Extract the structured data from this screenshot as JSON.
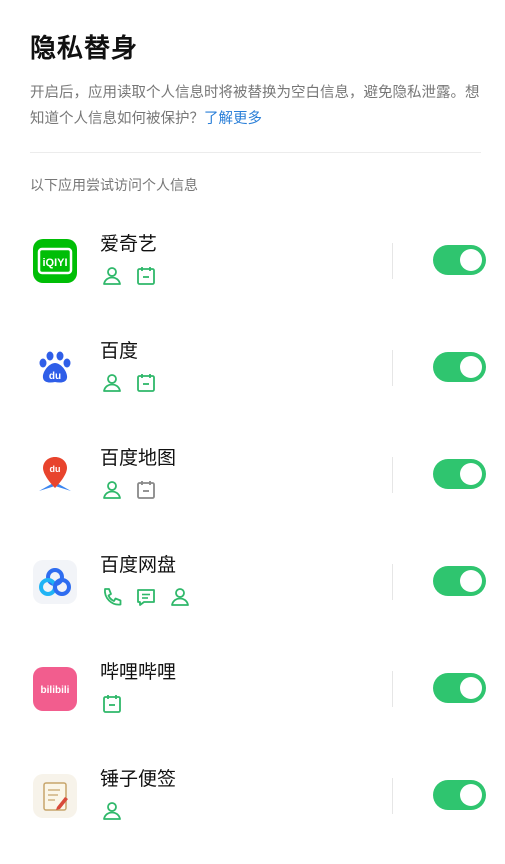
{
  "header": {
    "title": "隐私替身",
    "description": "开启后，应用读取个人信息时将被替换为空白信息，避免隐私泄露。想知道个人信息如何被保护？",
    "learn_more": "了解更多"
  },
  "section_label": "以下应用尝试访问个人信息",
  "colors": {
    "accent": "#2fc56f",
    "link": "#2a7fd8",
    "perm_icon": "#2fb86a"
  },
  "apps": [
    {
      "name": "爱奇艺",
      "icon": "iqiyi-app-icon",
      "icon_text": "iQIYI",
      "permissions": [
        "contact-icon",
        "calendar-icon"
      ],
      "enabled": true
    },
    {
      "name": "百度",
      "icon": "baidu-app-icon",
      "icon_text": "du",
      "permissions": [
        "contact-icon",
        "calendar-icon"
      ],
      "enabled": true
    },
    {
      "name": "百度地图",
      "icon": "baidu-map-app-icon",
      "icon_text": "du",
      "permissions": [
        "contact-icon",
        "calendar-icon"
      ],
      "enabled": true
    },
    {
      "name": "百度网盘",
      "icon": "baidu-netdisk-app-icon",
      "permissions": [
        "phone-icon",
        "message-icon",
        "contact-icon"
      ],
      "enabled": true
    },
    {
      "name": "哔哩哔哩",
      "icon": "bilibili-app-icon",
      "icon_text": "bilibili",
      "permissions": [
        "calendar-icon"
      ],
      "enabled": true
    },
    {
      "name": "锤子便签",
      "icon": "smartisan-notes-app-icon",
      "permissions": [
        "contact-icon"
      ],
      "enabled": true
    }
  ]
}
